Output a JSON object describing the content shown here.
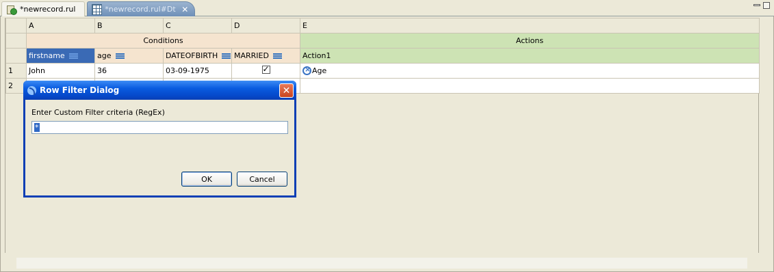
{
  "tabs": [
    {
      "label": "*newrecord.rul",
      "icon": "rule-file-icon",
      "active": false
    },
    {
      "label": "*newrecord.rul#Dt",
      "icon": "decision-table-icon",
      "active": true,
      "close": "✕"
    }
  ],
  "grid": {
    "column_letters": [
      "A",
      "B",
      "C",
      "D",
      "E"
    ],
    "group_headers": {
      "conditions": "Conditions",
      "actions": "Actions"
    },
    "columns": [
      {
        "label": "firstname",
        "filter_icon": "filter-icon",
        "selected": true
      },
      {
        "label": "age",
        "filter_icon": "filter-icon"
      },
      {
        "label": "DATEOFBIRTH",
        "filter_icon": "filter-icon"
      },
      {
        "label": "MARRIED",
        "filter_icon": "filter-icon"
      },
      {
        "label": "Action1"
      }
    ],
    "rows": [
      {
        "num": "1",
        "firstname": "John",
        "age": "36",
        "dob": "03-09-1975",
        "married": true,
        "action": "Age"
      },
      {
        "num": "2",
        "firstname": "",
        "age": "",
        "dob": "",
        "married": false,
        "action": ""
      }
    ]
  },
  "dialog": {
    "title": "Row Filter Dialog",
    "close": "✕",
    "label": "Enter Custom Filter criteria (RegEx)",
    "input_value": "*",
    "ok": "OK",
    "cancel": "Cancel"
  },
  "colors": {
    "conditions": "#f5e4cf",
    "actions": "#cde3b4",
    "selected_column": "#3a6ab5",
    "dialog_title": "#0a5ce0"
  }
}
